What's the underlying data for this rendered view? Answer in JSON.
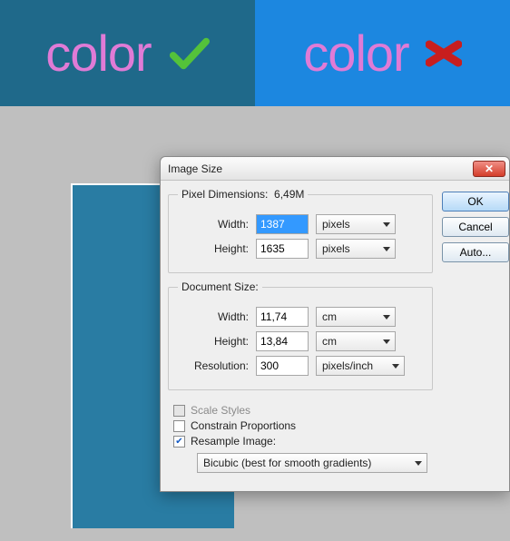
{
  "header": {
    "left_text": "color",
    "right_text": "color"
  },
  "dialog": {
    "title": "Image Size",
    "pixel_dimensions": {
      "legend": "Pixel Dimensions:",
      "size": "6,49M",
      "width_label": "Width:",
      "width_value": "1387",
      "width_unit": "pixels",
      "height_label": "Height:",
      "height_value": "1635",
      "height_unit": "pixels"
    },
    "document_size": {
      "legend": "Document Size:",
      "width_label": "Width:",
      "width_value": "11,74",
      "width_unit": "cm",
      "height_label": "Height:",
      "height_value": "13,84",
      "height_unit": "cm",
      "resolution_label": "Resolution:",
      "resolution_value": "300",
      "resolution_unit": "pixels/inch"
    },
    "options": {
      "scale_styles": "Scale Styles",
      "constrain": "Constrain Proportions",
      "resample": "Resample Image:",
      "method": "Bicubic (best for smooth gradients)"
    },
    "buttons": {
      "ok": "OK",
      "cancel": "Cancel",
      "auto": "Auto..."
    }
  }
}
